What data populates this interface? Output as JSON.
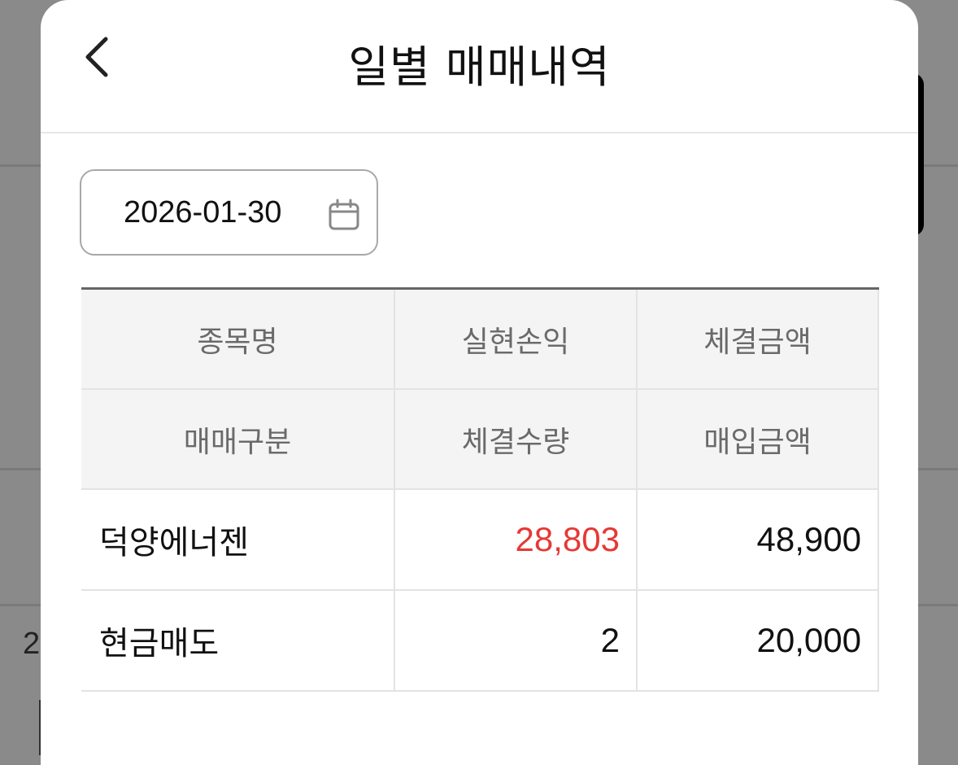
{
  "header": {
    "title": "일별 매매내역"
  },
  "date_filter": {
    "value": "2026-01-30"
  },
  "table": {
    "header_row1": [
      "종목명",
      "실현손익",
      "체결금액"
    ],
    "header_row2": [
      "매매구분",
      "체결수량",
      "매입금액"
    ],
    "rows": [
      {
        "name": "덕양에너젠",
        "realized_pnl": "28,803",
        "exec_amount": "48,900"
      },
      {
        "trade_type": "현금매도",
        "exec_qty": "2",
        "purchase_amount": "20,000"
      }
    ]
  },
  "background": {
    "partial_text": "2"
  },
  "colors": {
    "profit": "#e53935"
  }
}
